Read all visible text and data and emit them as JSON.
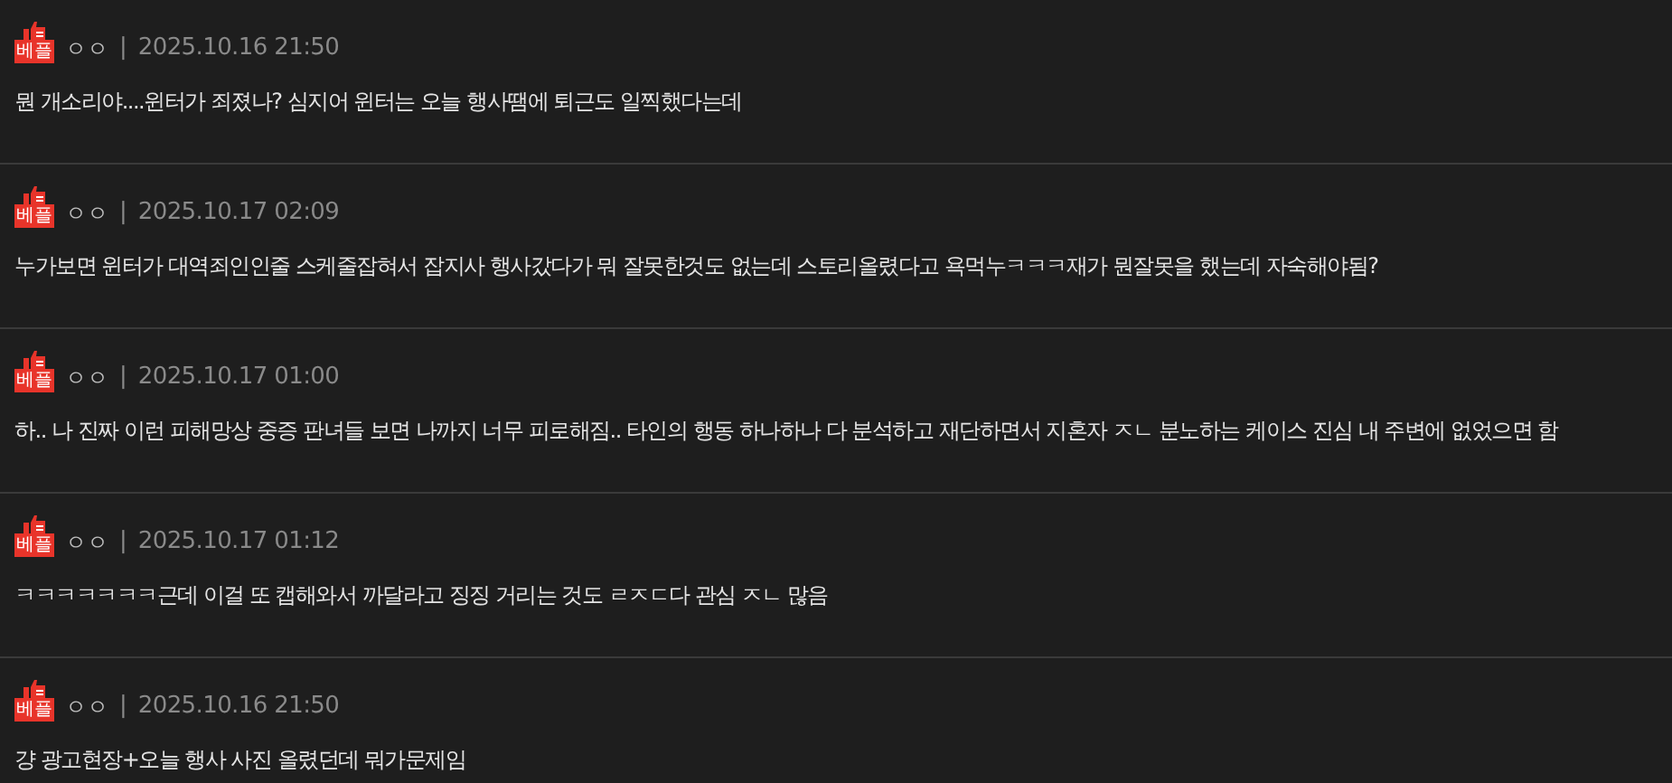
{
  "comments": [
    {
      "badge": "베플",
      "author": "ㅇㅇ",
      "separator": "|",
      "date": "2025.10.16 21:50",
      "text": "뭔 개소리야....윈터가 죄졌나? 심지어 윈터는 오늘 행사땜에 퇴근도 일찍했다는데"
    },
    {
      "badge": "베플",
      "author": "ㅇㅇ",
      "separator": "|",
      "date": "2025.10.17 02:09",
      "text": "누가보면 윈터가 대역죄인인줄 스케줄잡혀서 잡지사 행사갔다가 뭐 잘못한것도 없는데 스토리올렸다고 욕먹누ㅋㅋㅋ재가 뭔잘못을 했는데 자숙해야됨?"
    },
    {
      "badge": "베플",
      "author": "ㅇㅇ",
      "separator": "|",
      "date": "2025.10.17 01:00",
      "text": "하.. 나 진짜 이런 피해망상 중증 판녀들 보면 나까지 너무 피로해짐.. 타인의 행동 하나하나 다 분석하고 재단하면서 지혼자 ㅈㄴ 분노하는 케이스 진심 내 주변에 없었으면 함"
    },
    {
      "badge": "베플",
      "author": "ㅇㅇ",
      "separator": "|",
      "date": "2025.10.17 01:12",
      "text": "ㅋㅋㅋㅋㅋㅋㅋ근데 이걸 또 캡해와서 까달라고 징징 거리는 것도 ㄹㅈㄷ다 관심 ㅈㄴ 많음"
    },
    {
      "badge": "베플",
      "author": "ㅇㅇ",
      "separator": "|",
      "date": "2025.10.16 21:50",
      "text": "걍 광고현장+오늘 행사 사진 올렸던데 뭐가문제임"
    }
  ]
}
